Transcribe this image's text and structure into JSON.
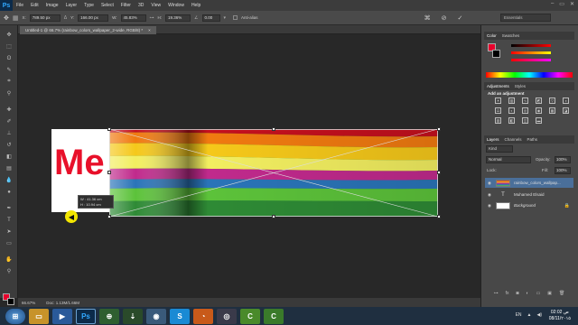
{
  "menubar": {
    "logo": "Ps",
    "items": [
      "File",
      "Edit",
      "Image",
      "Layer",
      "Type",
      "Select",
      "Filter",
      "3D",
      "View",
      "Window",
      "Help"
    ],
    "controls": [
      "–",
      "▭",
      "✕"
    ]
  },
  "options": {
    "x_label": "X:",
    "x_value": "789.50 px",
    "y_label": "Y:",
    "y_value": "166.00 px",
    "w_label": "W:",
    "w_value": "45.83%",
    "h_label": "H:",
    "h_value": "19.36%",
    "angle_value": "0.00",
    "antialias_label": "Anti-alias",
    "workspace": "Essentials"
  },
  "doc_tab": {
    "title": "Untitled-1 @ 66.7% (rainbow_colors_wallpaper_2-wide, RGB/8) *",
    "close": "×"
  },
  "canvas": {
    "doc_text": "Me",
    "info_line1": "W : 41.36 cm",
    "info_line2": "H : 10.94 cm"
  },
  "status": {
    "zoom": "66.67%",
    "doc": "Doc: 1.13M/1.66M"
  },
  "panels": {
    "color_tabs": [
      "Color",
      "Swatches"
    ],
    "adjust_tabs": [
      "Adjustments",
      "Styles"
    ],
    "adjust_heading": "Add an adjustment",
    "layers_tabs": [
      "Layers",
      "Channels",
      "Paths"
    ],
    "kind_label": "Kind",
    "blend_mode": "Normal",
    "opacity_label": "Opacity:",
    "opacity_value": "100%",
    "lock_label": "Lock:",
    "fill_label": "Fill:",
    "fill_value": "100%",
    "layers": [
      {
        "name": "rainbow_colors_wallpap..."
      },
      {
        "name": "Muhamed Elsaid"
      },
      {
        "name": "Background"
      }
    ]
  },
  "taskbar": {
    "lang": "EN",
    "time": "02:02 ص",
    "date": "08/11/٢٠١٥"
  },
  "colors": {
    "accent_red": "#e8102a",
    "panel_bg": "#484848",
    "canvas_bg": "#282828",
    "selected_layer": "#4a6f9a"
  }
}
